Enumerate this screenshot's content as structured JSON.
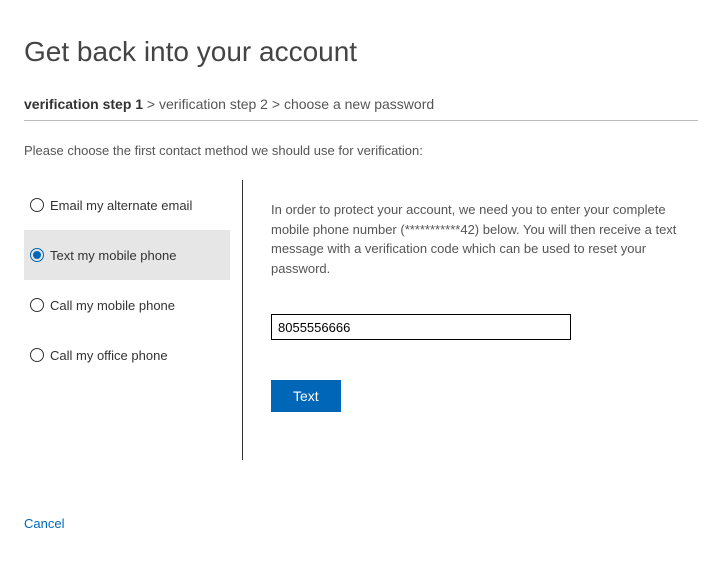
{
  "page": {
    "title": "Get back into your account"
  },
  "breadcrumb": {
    "step1": "verification step 1",
    "sep1": " > ",
    "step2": "verification step 2",
    "sep2": " > ",
    "step3": "choose a new password"
  },
  "instruction": "Please choose the first contact method we should use for verification:",
  "methods": {
    "email": "Email my alternate email",
    "text": "Text my mobile phone",
    "call_mobile": "Call my mobile phone",
    "call_office": "Call my office phone",
    "selected": "text"
  },
  "right": {
    "description": "In order to protect your account, we need you to enter your complete mobile phone number (***********42) below. You will then receive a text message with a verification code which can be used to reset your password.",
    "phone_value": "8055556666",
    "action_label": "Text"
  },
  "cancel_label": "Cancel"
}
